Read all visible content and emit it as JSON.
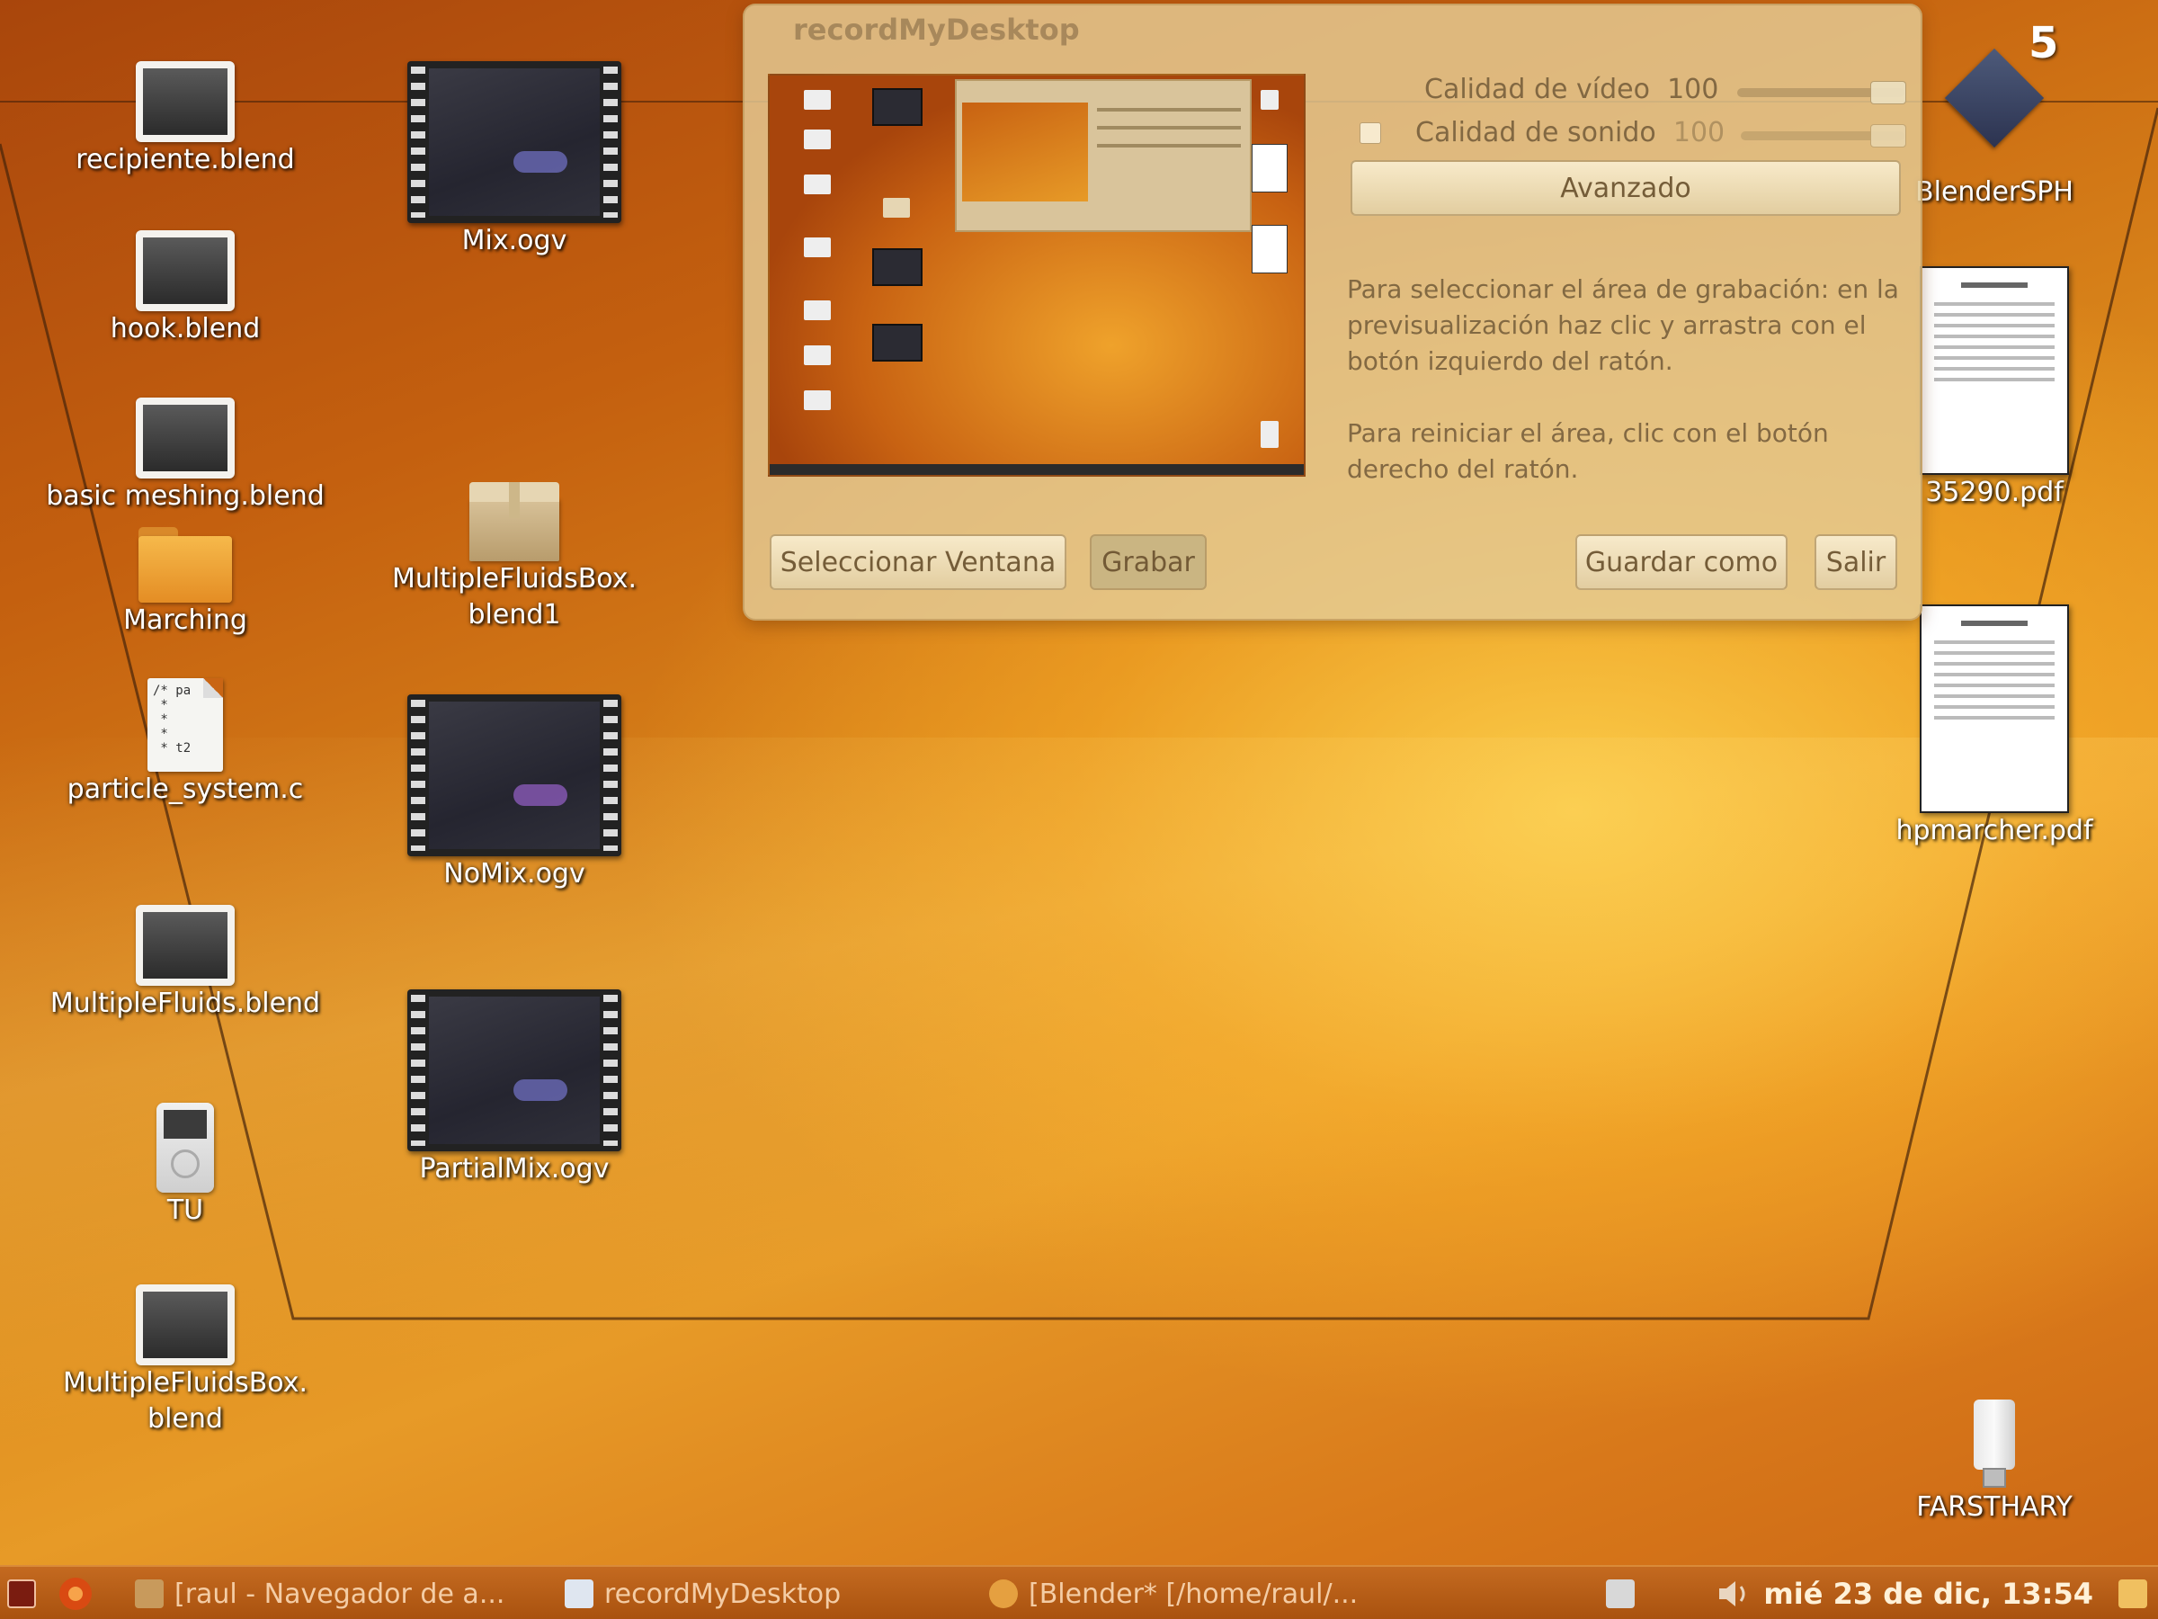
{
  "desktop": {
    "icons_left": [
      {
        "label": "recipiente.blend"
      },
      {
        "label": "hook.blend"
      },
      {
        "label": "basic meshing.blend"
      },
      {
        "label": "Marching"
      },
      {
        "label": "particle_system.c"
      },
      {
        "label": "MultipleFluids.blend"
      },
      {
        "label": "TU"
      },
      {
        "label": "MultipleFluidsBox.\nblend"
      }
    ],
    "icons_middle": [
      {
        "label": "Mix.ogv"
      },
      {
        "label": "MultipleFluidsBox.\nblend1"
      },
      {
        "label": "NoMix.ogv"
      },
      {
        "label": "PartialMix.ogv"
      }
    ],
    "icons_right": [
      {
        "label": "BlenderSPH"
      },
      {
        "label": "35290.pdf"
      },
      {
        "label": "hpmarcher.pdf"
      },
      {
        "label": "FARSTHARY"
      }
    ],
    "workspace_number": "5",
    "cfile_glyph": "/* pa\n *\n * \n *  \n * t2"
  },
  "window": {
    "title": "recordMyDesktop",
    "video_quality_label": "Calidad de vídeo",
    "video_quality_value": "100",
    "sound_quality_label": "Calidad de sonido",
    "sound_quality_value": "100",
    "video_quality_level": 1.0,
    "sound_quality_level": 1.0,
    "advanced_button": "Avanzado",
    "help_text_1": "Para seleccionar el área de grabación: en la previsualización haz clic y arrastra con el botón izquierdo del ratón.",
    "help_text_2": "Para reiniciar el área, clic con el botón derecho del ratón.",
    "buttons": {
      "select_window": "Seleccionar Ventana",
      "record": "Grabar",
      "save_as": "Guardar como",
      "quit": "Salir"
    }
  },
  "taskbar": {
    "items": [
      {
        "label": "[raul - Navegador de a..."
      },
      {
        "label": "recordMyDesktop"
      },
      {
        "label": "[Blender* [/home/raul/..."
      }
    ],
    "clock": "mié 23 de dic, 13:54"
  },
  "colors": {
    "wallpaper_dark": "#a9460c",
    "wallpaper_light": "#f4c040",
    "window_bg": "#e4cc96",
    "taskbar": "#b45c15"
  }
}
